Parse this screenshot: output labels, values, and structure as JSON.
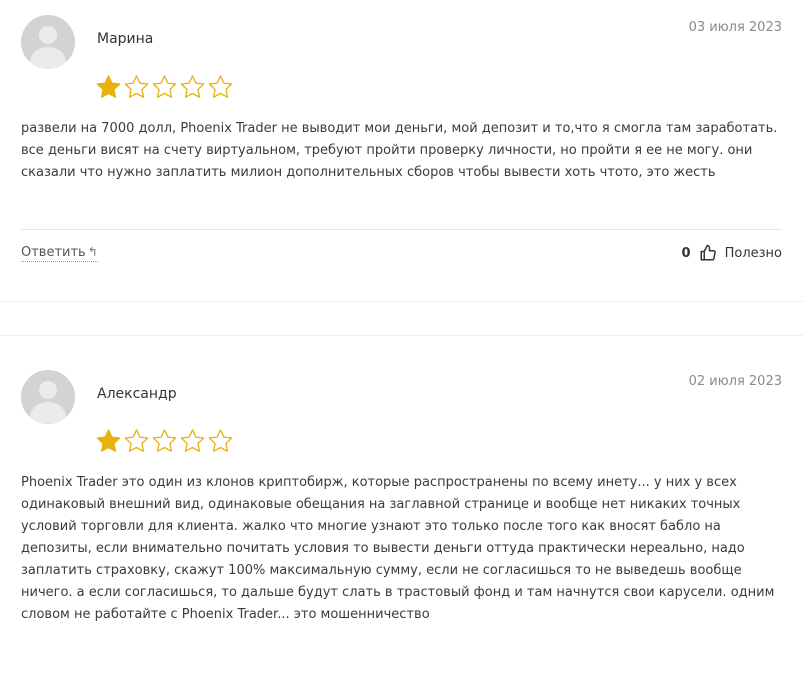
{
  "reviews": [
    {
      "author": "Марина",
      "date": "03 июля 2023",
      "rating": 1,
      "max_rating": 5,
      "text": "развели на 7000 долл, Phoenix Trader не выводит мои деньги, мой депозит и то,что я смогла там заработать. все деньги висят на счету виртуальном, требуют пройти проверку личности, но пройти я ее не могу. они сказали что нужно заплатить милион дополнительных сборов чтобы вывести хоть чтото, это жесть",
      "reply_label": "Ответить",
      "reply_icon": "↰",
      "helpful_count": "0",
      "helpful_label": "Полезно"
    },
    {
      "author": "Александр",
      "date": "02 июля 2023",
      "rating": 1,
      "max_rating": 5,
      "text": "Phoenix Trader это один из клонов криптобирж, которые распространены по всему инету... у них у всех одинаковый внешний вид, одинаковые обещания на заглавной странице и вообще нет никаких точных условий торговли для клиента. жалко что многие узнают это только после того как вносят бабло на депозиты, если внимательно почитать условия то вывести деньги оттуда практически нереально, надо заплатить страховку, скажут 100% максимальную сумму, если не согласишься то не выведешь вообще ничего. а если согласишься, то дальше будут слать в трастовый фонд и там начнутся свои карусели. одним словом не работайте с Phoenix Trader... это мошенничество"
    }
  ],
  "colors": {
    "star_filled": "#e8b10e",
    "star_empty": "#e8b10e",
    "date": "#8a8a8a",
    "avatar_bg": "#d3d3d3"
  },
  "icons": {
    "avatar": "user-placeholder-icon",
    "star": "star-icon",
    "reply": "reply-arrow-icon",
    "like": "thumbs-up-icon"
  }
}
